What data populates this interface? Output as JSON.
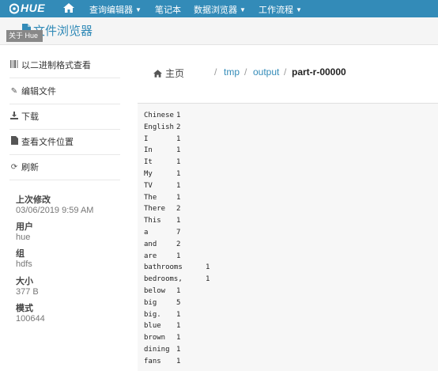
{
  "nav": {
    "logo": "HUE",
    "items": [
      {
        "label": "查询编辑器",
        "dropdown": true
      },
      {
        "label": "笔记本",
        "dropdown": false
      },
      {
        "label": "数据浏览器",
        "dropdown": true
      },
      {
        "label": "工作流程",
        "dropdown": true
      }
    ]
  },
  "header": {
    "about_tag": "关于 Hue",
    "title": "文件浏览器"
  },
  "sidebar": {
    "actions": [
      {
        "label": "以二进制格式查看",
        "icon": "binary-icon"
      },
      {
        "label": "编辑文件",
        "icon": "pencil-icon"
      },
      {
        "label": "下载",
        "icon": "download-icon"
      },
      {
        "label": "查看文件位置",
        "icon": "file-icon"
      },
      {
        "label": "刷新",
        "icon": "refresh-icon"
      }
    ],
    "meta": {
      "modified_label": "上次修改",
      "modified_value": "03/06/2019 9:59 AM",
      "user_label": "用户",
      "user_value": "hue",
      "group_label": "组",
      "group_value": "hdfs",
      "size_label": "大小",
      "size_value": "377 B",
      "mode_label": "模式",
      "mode_value": "100644"
    }
  },
  "breadcrumb": {
    "home": "主页",
    "parts": [
      "tmp",
      "output"
    ],
    "current": "part-r-00000"
  },
  "file_lines": [
    {
      "word": "Chinese",
      "count": "1"
    },
    {
      "word": "English",
      "count": "2"
    },
    {
      "word": "I",
      "count": "1"
    },
    {
      "word": "In",
      "count": "1"
    },
    {
      "word": "It",
      "count": "1"
    },
    {
      "word": "My",
      "count": "1"
    },
    {
      "word": "TV",
      "count": "1"
    },
    {
      "word": "The",
      "count": "1"
    },
    {
      "word": "There",
      "count": "2"
    },
    {
      "word": "This",
      "count": "1"
    },
    {
      "word": "a",
      "count": "7"
    },
    {
      "word": "and",
      "count": "2"
    },
    {
      "word": "are",
      "count": "1"
    },
    {
      "word": "bathrooms",
      "count": "1"
    },
    {
      "word": "bedrooms,",
      "count": "1"
    },
    {
      "word": "below",
      "count": "1"
    },
    {
      "word": "big",
      "count": "5"
    },
    {
      "word": "big.",
      "count": "1"
    },
    {
      "word": "blue",
      "count": "1"
    },
    {
      "word": "brown",
      "count": "1"
    },
    {
      "word": "dining",
      "count": "1"
    },
    {
      "word": "fans",
      "count": "1"
    }
  ]
}
